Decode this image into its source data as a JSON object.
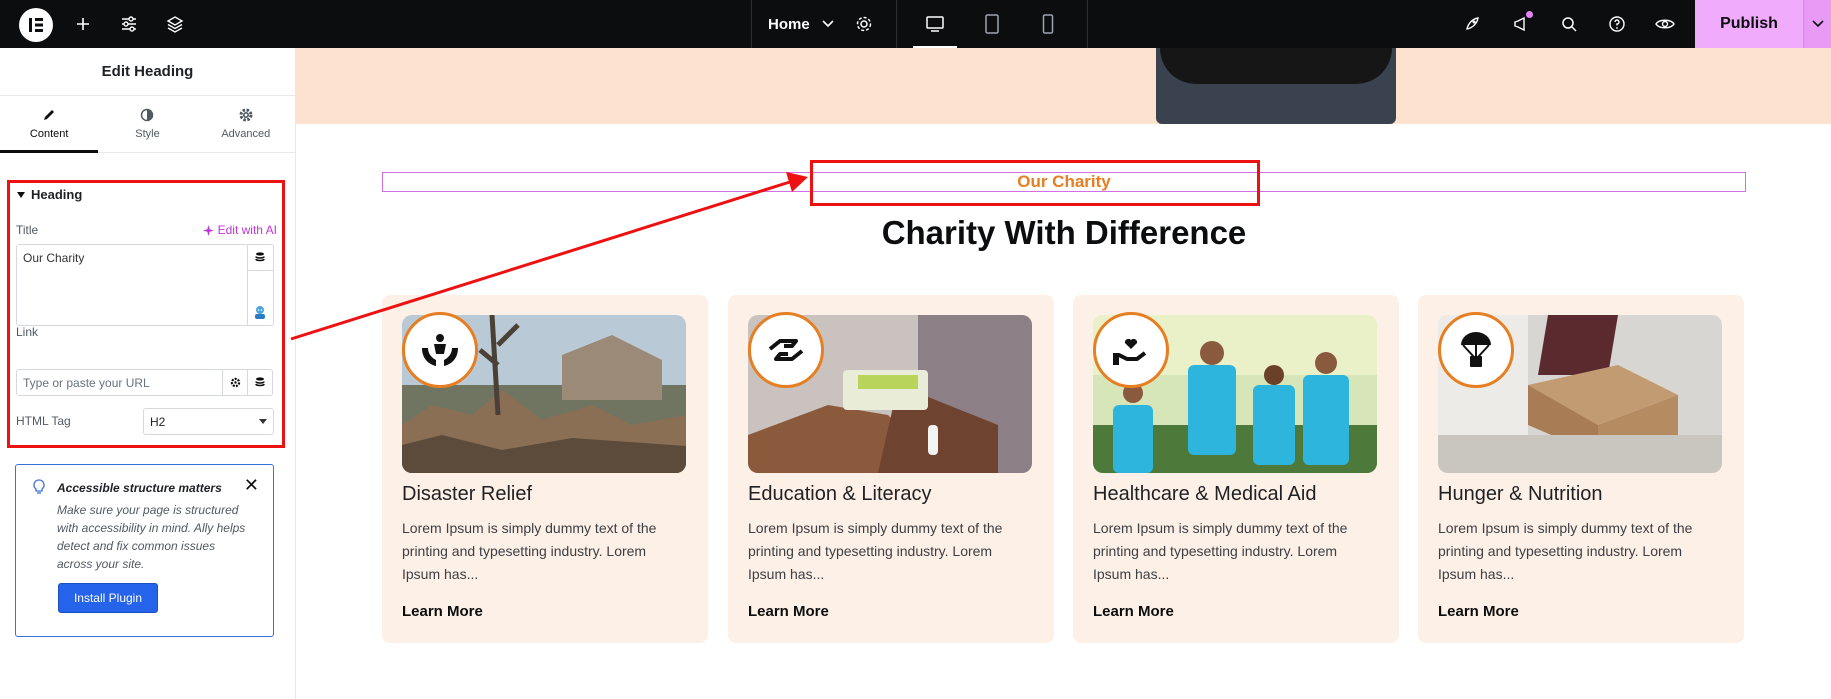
{
  "topbar": {
    "page_name": "Home",
    "publish_label": "Publish"
  },
  "panel": {
    "title": "Edit Heading",
    "tabs": [
      {
        "label": "Content"
      },
      {
        "label": "Style"
      },
      {
        "label": "Advanced"
      }
    ],
    "section_title": "Heading",
    "title_label": "Title",
    "edit_ai_label": "Edit with AI",
    "title_value": "Our Charity",
    "link_label": "Link",
    "link_placeholder": "Type or paste your URL",
    "html_tag_label": "HTML Tag",
    "html_tag_value": "H2",
    "notice": {
      "title": "Accessible structure matters",
      "text": "Make sure your page is structured with accessibility in mind. Ally helps detect and fix common issues across your site.",
      "button": "Install Plugin"
    }
  },
  "canvas": {
    "sub_heading": "Our Charity",
    "main_heading": "Charity With Difference",
    "cards": [
      {
        "title": "Disaster Relief",
        "desc": "Lorem Ipsum is simply dummy text of the printing and typesetting industry. Lorem Ipsum has...",
        "link": "Learn More",
        "icon": "hands-people-icon"
      },
      {
        "title": "Education & Literacy",
        "desc": "Lorem Ipsum is simply dummy text of the printing and typesetting industry. Lorem Ipsum has...",
        "link": "Learn More",
        "icon": "hand-helping-icon"
      },
      {
        "title": "Healthcare & Medical Aid",
        "desc": "Lorem Ipsum is simply dummy text of the printing and typesetting industry. Lorem Ipsum has...",
        "link": "Learn More",
        "icon": "hand-heart-icon"
      },
      {
        "title": "Hunger & Nutrition",
        "desc": "Lorem Ipsum is simply dummy text of the printing and typesetting industry. Lorem Ipsum has...",
        "link": "Learn More",
        "icon": "parachute-box-icon"
      }
    ]
  },
  "colors": {
    "accent_orange": "#e67e22",
    "publish_pink": "#f0abfc",
    "highlight_red": "#ee1111",
    "card_bg": "#fdf0e6"
  }
}
